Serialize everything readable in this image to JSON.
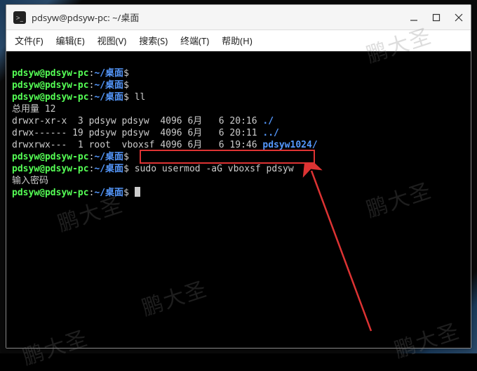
{
  "titlebar": {
    "title": "pdsyw@pdsyw-pc: ~/桌面"
  },
  "menubar": {
    "items": [
      {
        "label": "文件(F)"
      },
      {
        "label": "编辑(E)"
      },
      {
        "label": "视图(V)"
      },
      {
        "label": "搜索(S)"
      },
      {
        "label": "终端(T)"
      },
      {
        "label": "帮助(H)"
      }
    ]
  },
  "terminal": {
    "prompt_user": "pdsyw@pdsyw-pc",
    "prompt_sep": ":",
    "prompt_path": "~/桌面",
    "prompt_end": "$",
    "lines": {
      "p1_cmd": "",
      "p2_cmd": "",
      "p3_cmd": "ll",
      "total": "总用量 12",
      "row1": "drwxr-xr-x  3 pdsyw pdsyw  4096 6月   6 20:16 ",
      "row1_dir": "./",
      "row2": "drwx------ 19 pdsyw pdsyw  4096 6月   6 20:11 ",
      "row2_dir": "../",
      "row3": "drwxrwx---  1 root  vboxsf 4096 6月   6 19:46 ",
      "row3_dir": "pdsyw1024/",
      "p4_cmd": "",
      "p5_cmd": "sudo usermod -aG vboxsf pdsyw",
      "pwd_prompt": "输入密码",
      "p6_cmd": ""
    }
  },
  "watermark": "鹏大圣"
}
